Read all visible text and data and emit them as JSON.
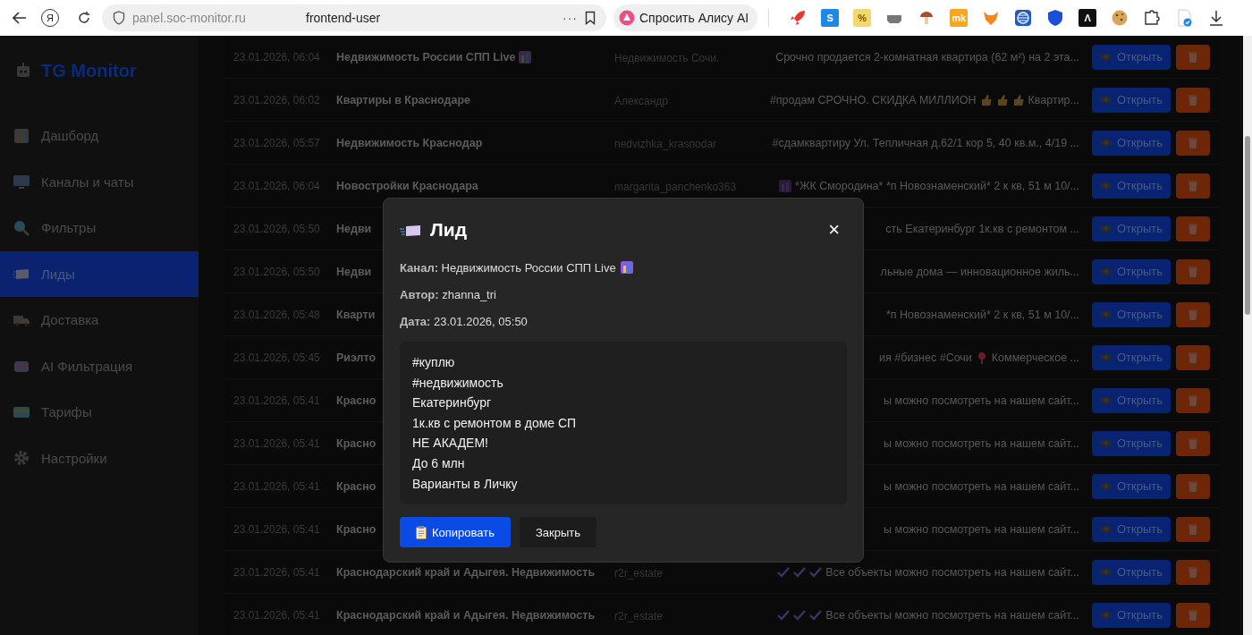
{
  "browser": {
    "logo": "Я",
    "url_domain": "panel.soc-monitor.ru",
    "url_path": "frontend-user",
    "more": "···",
    "alice_button": "Спросить Алису AI",
    "extensions": [
      {
        "kind": "rocket"
      },
      {
        "kind": "tile",
        "label": "S",
        "color": "#1e88e5"
      },
      {
        "kind": "tile",
        "label": "%",
        "color": "#f5d76e"
      },
      {
        "kind": "tray"
      },
      {
        "kind": "mushroom"
      },
      {
        "kind": "tile",
        "label": "mk",
        "color": "#f5a623"
      },
      {
        "kind": "fox"
      },
      {
        "kind": "globe"
      },
      {
        "kind": "shield"
      },
      {
        "kind": "tile",
        "label": "Λ",
        "color": "#111111"
      },
      {
        "kind": "cookie"
      },
      {
        "kind": "puzzle"
      },
      {
        "kind": "doc"
      },
      {
        "kind": "download"
      }
    ]
  },
  "sidebar": {
    "logo": "TG Monitor",
    "items": [
      {
        "label": "Дашборд",
        "selected": false
      },
      {
        "label": "Каналы и чаты",
        "selected": false
      },
      {
        "label": "Фильтры",
        "selected": false
      },
      {
        "label": "Лиды",
        "selected": true
      },
      {
        "label": "Доставка",
        "selected": false
      },
      {
        "label": "AI Фильтрация",
        "selected": false
      },
      {
        "label": "Тарифы",
        "selected": false
      },
      {
        "label": "Настройки",
        "selected": false
      }
    ]
  },
  "table": {
    "rows": [
      {
        "date": "23.01.2026, 06:04",
        "channel": "Недвижимость России СПП Live",
        "channel_icon": true,
        "author": "Недвижимость Сочи.",
        "message": [
          {
            "kind": "text",
            "text": "Срочно продается 2-комнатная квартира (62 м²) на 2 эта..."
          }
        ],
        "open_label": "Открыть"
      },
      {
        "date": "23.01.2026, 06:02",
        "channel": "Квартиры в Краснодаре",
        "channel_icon": false,
        "author": "Александр",
        "message": [
          {
            "kind": "text",
            "text": "#продам СРОЧНО. СКИДКА МИЛЛИОН"
          },
          {
            "kind": "thumb"
          },
          {
            "kind": "thumb"
          },
          {
            "kind": "thumb"
          },
          {
            "kind": "text",
            "text": "Квартир..."
          }
        ],
        "open_label": "Открыть"
      },
      {
        "date": "23.01.2026, 05:57",
        "channel": "Недвижимость Краснодар",
        "channel_icon": false,
        "author": "nedvizhka_krasnodar",
        "message": [
          {
            "kind": "text",
            "text": "#сдамквартиру Ул. Тепличная д.62/1 кор 5, 40 кв.м., 4/19 ..."
          }
        ],
        "open_label": "Открыть"
      },
      {
        "date": "23.01.2026, 06:04",
        "channel": "Новостройки Краснодара",
        "channel_icon": false,
        "author": "margarita_panchenko363",
        "message": [
          {
            "kind": "city"
          },
          {
            "kind": "text",
            "text": "*ЖК Смородина* *п Новознаменский* 2 к кв, 51 м 10/..."
          }
        ],
        "open_label": "Открыть"
      },
      {
        "date": "23.01.2026, 05:50",
        "channel": "Недви",
        "channel_icon": false,
        "message": [
          {
            "kind": "text",
            "text": "сть Екатеринбург 1к.кв с ремонтом ..."
          }
        ],
        "open_label": "Открыть"
      },
      {
        "date": "23.01.2026, 05:50",
        "channel": "Недви",
        "channel_icon": false,
        "message": [
          {
            "kind": "text",
            "text": "льные дома — инновационное жиль..."
          }
        ],
        "open_label": "Открыть"
      },
      {
        "date": "23.01.2026, 05:48",
        "channel": "Кварти",
        "channel_icon": false,
        "message": [
          {
            "kind": "text",
            "text": "*п Новознаменский* 2 к кв, 51 м 10/..."
          }
        ],
        "open_label": "Открыть"
      },
      {
        "date": "23.01.2026, 05:45",
        "channel": "Риэлто",
        "channel_icon": false,
        "message": [
          {
            "kind": "text",
            "text": "ия #бизнес #Сочи"
          },
          {
            "kind": "pin"
          },
          {
            "kind": "text",
            "text": "Коммерческое ..."
          }
        ],
        "open_label": "Открыть"
      },
      {
        "date": "23.01.2026, 05:41",
        "channel": "Красно",
        "channel_icon": false,
        "message": [
          {
            "kind": "text",
            "text": "ы можно посмотреть на нашем сайт..."
          }
        ],
        "open_label": "Открыть"
      },
      {
        "date": "23.01.2026, 05:41",
        "channel": "Красно",
        "channel_icon": false,
        "message": [
          {
            "kind": "text",
            "text": "ы можно посмотреть на нашем сайт..."
          }
        ],
        "open_label": "Открыть"
      },
      {
        "date": "23.01.2026, 05:41",
        "channel": "Красно",
        "channel_icon": false,
        "message": [
          {
            "kind": "text",
            "text": "ы можно посмотреть на нашем сайт..."
          }
        ],
        "open_label": "Открыть"
      },
      {
        "date": "23.01.2026, 05:41",
        "channel": "Красно",
        "channel_icon": false,
        "message": [
          {
            "kind": "text",
            "text": "ы можно посмотреть на нашем сайт..."
          }
        ],
        "open_label": "Открыть"
      },
      {
        "date": "23.01.2026, 05:41",
        "channel": "Краснодарский край и Адыгея. Недвижимость",
        "channel_icon": false,
        "author": "r2r_estate",
        "message": [
          {
            "kind": "check"
          },
          {
            "kind": "check"
          },
          {
            "kind": "check"
          },
          {
            "kind": "text",
            "text": "Все объекты можно посмотреть на нашем сайт..."
          }
        ],
        "open_label": "Открыть"
      },
      {
        "date": "23.01.2026, 05:41",
        "channel": "Краснодарский край и Адыгея. Недвижимость",
        "channel_icon": false,
        "author": "r2r_estate",
        "message": [
          {
            "kind": "check"
          },
          {
            "kind": "check"
          },
          {
            "kind": "check"
          },
          {
            "kind": "text",
            "text": "Все объекты можно посмотреть на нашем сайт..."
          }
        ],
        "open_label": "Открыть"
      }
    ]
  },
  "modal": {
    "title": "Лид",
    "close": "×",
    "fields": [
      {
        "label": "Канал:",
        "value": "Недвижимость России СПП Live",
        "icon": true
      },
      {
        "label": "Автор:",
        "value": "zhanna_tri",
        "icon": false
      },
      {
        "label": "Дата:",
        "value": "23.01.2026, 05:50",
        "icon": false
      }
    ],
    "message_lines": [
      "#куплю",
      "#недвижимость",
      "Екатеринбург",
      "1к.кв с ремонтом в доме СП",
      "НЕ АКАДЕМ!",
      "До 6 млн",
      "Варианты в Личку"
    ],
    "buttons": [
      {
        "label": "Копировать",
        "kind": "primary"
      },
      {
        "label": "Закрыть",
        "kind": "secondary"
      }
    ]
  }
}
